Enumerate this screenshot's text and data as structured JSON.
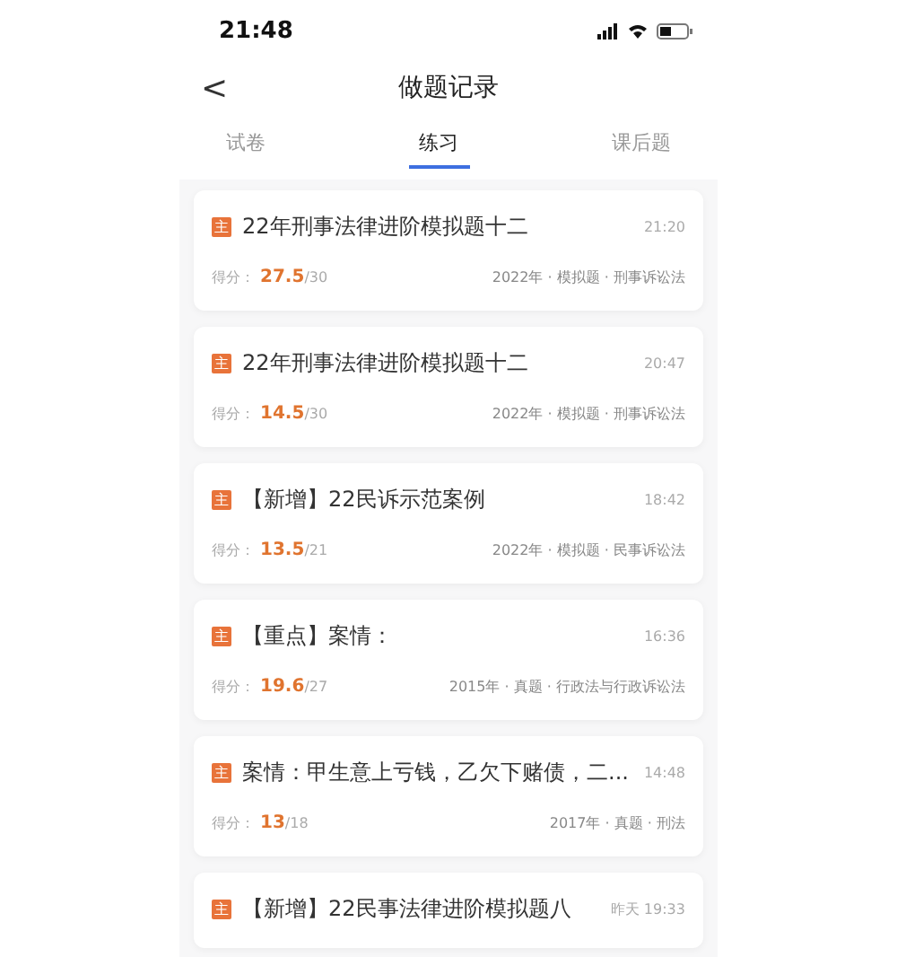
{
  "status_bar": {
    "time": "21:48"
  },
  "header": {
    "back": "<",
    "title": "做题记录"
  },
  "tabs": [
    {
      "label": "试卷",
      "selected": false
    },
    {
      "label": "练习",
      "selected": true
    },
    {
      "label": "课后题",
      "selected": false
    }
  ],
  "records": [
    {
      "badge": "主",
      "title": "22年刑事法律进阶模拟题十二",
      "time": "21:20",
      "score_label": "得分：",
      "score": "27.5",
      "total": "/30",
      "meta": "2022年 · 模拟题 · 刑事诉讼法"
    },
    {
      "badge": "主",
      "title": "22年刑事法律进阶模拟题十二",
      "time": "20:47",
      "score_label": "得分：",
      "score": "14.5",
      "total": "/30",
      "meta": "2022年 · 模拟题 · 刑事诉讼法"
    },
    {
      "badge": "主",
      "title": "【新增】22民诉示范案例",
      "time": "18:42",
      "score_label": "得分：",
      "score": "13.5",
      "total": "/21",
      "meta": "2022年 · 模拟题 · 民事诉讼法"
    },
    {
      "badge": "主",
      "title": "【重点】案情：",
      "time": "16:36",
      "score_label": "得分：",
      "score": "19.6",
      "total": "/27",
      "meta": "2015年 · 真题 · 行政法与行政诉讼法"
    },
    {
      "badge": "主",
      "title": "案情：甲生意上亏钱，乙欠下赌债，二...",
      "time": "14:48",
      "score_label": "得分：",
      "score": "13",
      "total": "/18",
      "meta": "2017年 · 真题 · 刑法"
    },
    {
      "badge": "主",
      "title": "【新增】22民事法律进阶模拟题八",
      "time": "昨天 19:33"
    }
  ]
}
